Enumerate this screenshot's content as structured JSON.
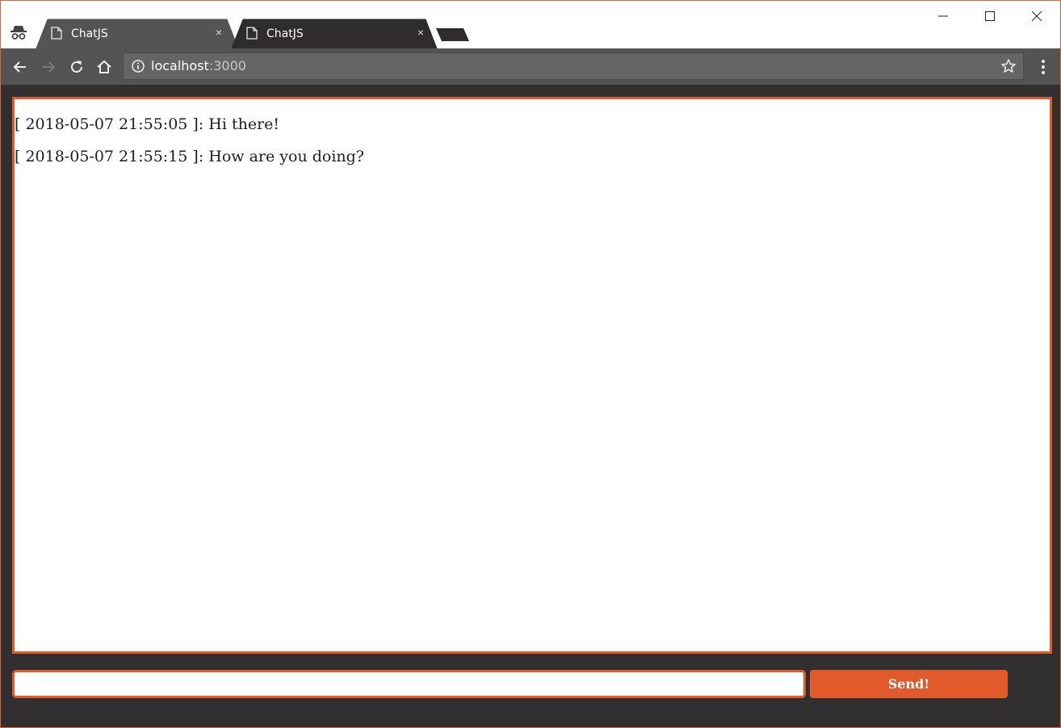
{
  "browser": {
    "tabs": [
      {
        "title": "ChatJS",
        "icon": "document-icon",
        "close": "×"
      },
      {
        "title": "ChatJS",
        "icon": "document-icon",
        "close": "×"
      }
    ],
    "address": {
      "host": "localhost",
      "port": ":3000"
    },
    "window_controls": [
      "minimize",
      "maximize",
      "close"
    ]
  },
  "chat": {
    "messages": [
      {
        "text": "[ 2018-05-07 21:55:05 ]: Hi there!"
      },
      {
        "text": "[ 2018-05-07 21:55:15 ]: How are you doing?"
      }
    ],
    "input": {
      "value": "",
      "placeholder": ""
    },
    "send_label": "Send!"
  },
  "colors": {
    "accent": "#e05a2b",
    "background": "#322f31",
    "toolbar": "#545454",
    "omnibox": "#656565"
  }
}
